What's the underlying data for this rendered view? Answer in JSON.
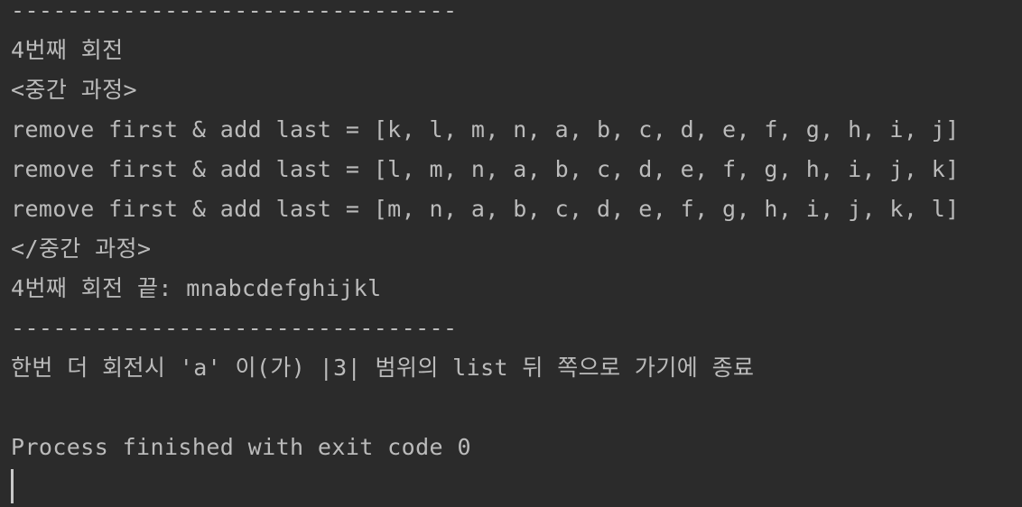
{
  "console": {
    "lines": [
      "--------------------------------",
      "4번째 회전",
      "<중간 과정>",
      "remove first & add last = [k, l, m, n, a, b, c, d, e, f, g, h, i, j]",
      "remove first & add last = [l, m, n, a, b, c, d, e, f, g, h, i, j, k]",
      "remove first & add last = [m, n, a, b, c, d, e, f, g, h, i, j, k, l]",
      "</중간 과정>",
      "4번째 회전 끝: mnabcdefghijkl",
      "--------------------------------",
      "한번 더 회전시 'a' 이(가) |3| 범위의 list 뒤 쪽으로 가기에 종료",
      "",
      "Process finished with exit code 0"
    ]
  }
}
